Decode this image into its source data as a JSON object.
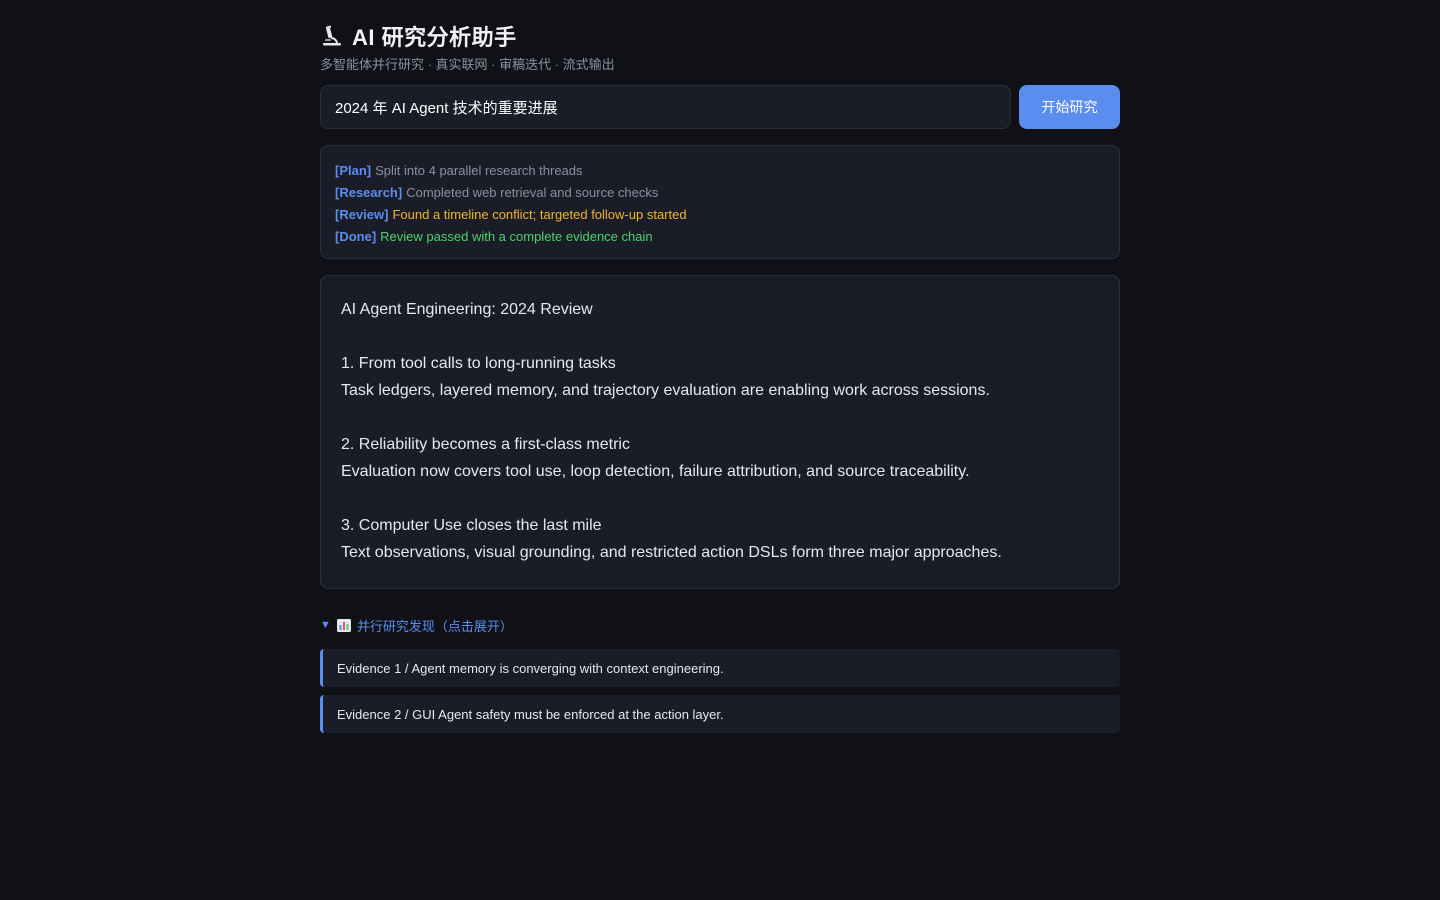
{
  "header": {
    "title": "AI 研究分析助手",
    "subtitle": "多智能体并行研究 · 真实联网 · 审稿迭代 · 流式输出",
    "icon": "microscope-icon"
  },
  "search": {
    "value": "2024 年 AI Agent 技术的重要进展",
    "button_label": "开始研究"
  },
  "log": [
    {
      "tag": "[Plan]",
      "text": "Split into 4 parallel research threads",
      "status": "info"
    },
    {
      "tag": "[Research]",
      "text": "Completed web retrieval and source checks",
      "status": "info"
    },
    {
      "tag": "[Review]",
      "text": "Found a timeline conflict; targeted follow-up started",
      "status": "warn"
    },
    {
      "tag": "[Done]",
      "text": "Review passed with a complete evidence chain",
      "status": "ok"
    }
  ],
  "report": {
    "title": "AI Agent Engineering: 2024 Review",
    "sections": [
      {
        "heading": "1. From tool calls to long-running tasks",
        "body": "Task ledgers, layered memory, and trajectory evaluation are enabling work across sessions."
      },
      {
        "heading": "2. Reliability becomes a first-class metric",
        "body": "Evaluation now covers tool use, loop detection, failure attribution, and source traceability."
      },
      {
        "heading": "3. Computer Use closes the last mile",
        "body": "Text observations, visual grounding, and restricted action DSLs form three major approaches."
      }
    ]
  },
  "findings": {
    "toggle_label": "并行研究发现（点击展开）",
    "toggle_icon": "bar-chart-icon",
    "items": [
      "Evidence 1 / Agent memory is converging with context engineering.",
      "Evidence 2 / GUI Agent safety must be enforced at the action layer."
    ]
  },
  "colors": {
    "background": "#0f1117",
    "panel": "#1a1d27",
    "accent": "#5b8def",
    "warn": "#f0b429",
    "ok": "#4cd26b",
    "muted": "#8b90a0"
  }
}
